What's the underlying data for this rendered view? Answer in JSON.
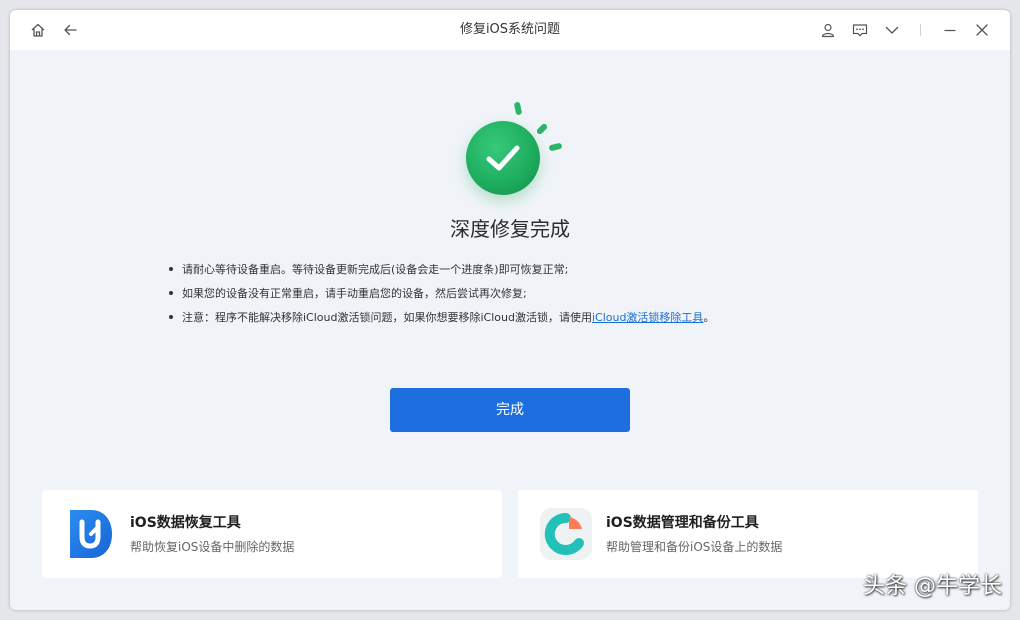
{
  "window": {
    "title": "修复iOS系统问题",
    "icons": [
      "home-icon",
      "back-arrow-icon",
      "user-icon",
      "feedback-icon",
      "chevron-down-icon",
      "minimize-icon",
      "close-icon"
    ]
  },
  "main": {
    "heading": "深度修复完成",
    "notes": [
      {
        "text": "请耐心等待设备重启。等待设备更新完成后(设备会走一个进度条)即可恢复正常;"
      },
      {
        "text": "如果您的设备没有正常重启，请手动重启您的设备，然后尝试再次修复;"
      },
      {
        "text": "注意：程序不能解决移除iCloud激活锁问题，如果你想要移除iCloud激活锁，请使用",
        "link": "iCloud激活锁移除工具",
        "suffix": "。"
      }
    ],
    "done_label": "完成"
  },
  "cards": [
    {
      "title": "iOS数据恢复工具",
      "subtitle": "帮助恢复iOS设备中删除的数据",
      "icon": "data-recovery-logo-icon"
    },
    {
      "title": "iOS数据管理和备份工具",
      "subtitle": "帮助管理和备份iOS设备上的数据",
      "icon": "data-manager-logo-icon"
    }
  ],
  "watermark": "头条 @牛学长",
  "colors": {
    "accent": "#1d6fe0",
    "success": "#1fae5f",
    "link": "#1a6fd8",
    "background": "#f0f4f8"
  }
}
